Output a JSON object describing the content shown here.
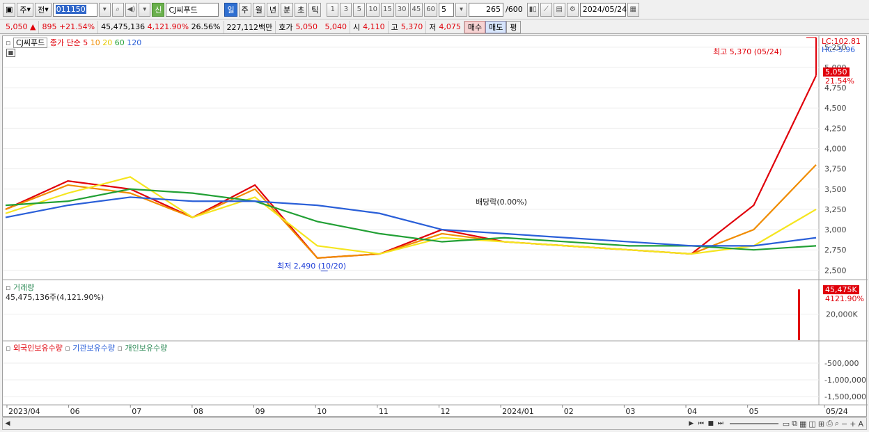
{
  "toolbar": {
    "period_main": "주",
    "period_prev": "전",
    "stock_code": "011150",
    "badge_new": "신",
    "stock_name": "CJ씨푸드",
    "periods": [
      "일",
      "주",
      "월",
      "년",
      "분",
      "초",
      "틱"
    ],
    "selected_period": "일",
    "intervals": [
      "1",
      "3",
      "5",
      "10",
      "15",
      "30",
      "45",
      "60"
    ],
    "interval_input": "5",
    "count": "265",
    "count_total": "/600",
    "date": "2024/05/24"
  },
  "quote": {
    "price": "5,050",
    "change": "895",
    "change_pct": "+21.54%",
    "volume": "45,475,136",
    "volume_pct": "4,121.90%",
    "turnover_pct": "26.56%",
    "amount": "227,112백만",
    "ask_label": "호가",
    "ask": "5,050",
    "bid": "5,040",
    "open_label": "시",
    "open": "4,110",
    "high_label": "고",
    "high": "5,370",
    "low_label": "저",
    "low": "4,075",
    "buy_label": "매수",
    "sell_label": "매도",
    "extra_label": "평"
  },
  "price_pane": {
    "name_label": "CJ씨푸드",
    "ma_label": "종가 단순",
    "ma_periods": [
      "5",
      "10",
      "20",
      "60",
      "120"
    ],
    "lc_label": "LC:102.81",
    "hc_label": "HC:-5.96",
    "axis_ticks": [
      "5,250",
      "5,000",
      "4,750",
      "4,500",
      "4,250",
      "4,000",
      "3,750",
      "3,500",
      "3,250",
      "3,000",
      "2,750",
      "2,500"
    ],
    "current_tag": "5,050",
    "current_pct": "21.54%",
    "high_annotation": "최고 5,370 (05/24)",
    "low_annotation": "최저 2,490 (10/20)",
    "dividend_annotation": "배당락(0.00%)"
  },
  "volume_pane": {
    "title": "거래량",
    "value_label": "45,475,136주(4,121.90%)",
    "axis_tick": "20,000K",
    "current_tag": "45,475K",
    "current_pct": "4121.90%"
  },
  "holding_pane": {
    "foreign_label": "외국인보유수량",
    "inst_label": "기관보유수량",
    "indiv_label": "개인보유수량",
    "axis_ticks": [
      "-500,000",
      "-1,000,000",
      "-1,500,000"
    ]
  },
  "x_axis": {
    "labels": [
      "2023/04",
      "06",
      "07",
      "08",
      "09",
      "10",
      "11",
      "12",
      "2024/01",
      "02",
      "03",
      "04",
      "05",
      "05/24"
    ]
  },
  "colors": {
    "up": "#e0000a",
    "down": "#1f3fd8",
    "ma5": "#e0000a",
    "ma10": "#f08c00",
    "ma20": "#f5e51f",
    "ma60": "#22a035",
    "ma120": "#2a5fd8",
    "foreign": "#e0000a",
    "institution": "#2a5fd8",
    "individual": "#2e8b57"
  },
  "chart_data": {
    "type": "line",
    "title": "CJ씨푸드",
    "x": [
      "2023/04",
      "06",
      "07",
      "08",
      "09",
      "10",
      "11",
      "12",
      "2024/01",
      "02",
      "03",
      "04",
      "05",
      "05/24"
    ],
    "ylim": [
      2400,
      5300
    ],
    "series": [
      {
        "name": "5",
        "values": [
          3250,
          3600,
          3500,
          3150,
          3550,
          2650,
          2700,
          3000,
          2850,
          2800,
          2750,
          2700,
          3300,
          4900
        ]
      },
      {
        "name": "10",
        "values": [
          3250,
          3550,
          3450,
          3150,
          3500,
          2650,
          2700,
          2950,
          2850,
          2800,
          2750,
          2700,
          3000,
          3800
        ]
      },
      {
        "name": "20",
        "values": [
          3200,
          3450,
          3650,
          3150,
          3400,
          2800,
          2700,
          2900,
          2850,
          2800,
          2750,
          2700,
          2800,
          3250
        ]
      },
      {
        "name": "60",
        "values": [
          3300,
          3350,
          3500,
          3450,
          3350,
          3100,
          2950,
          2850,
          2900,
          2850,
          2800,
          2800,
          2750,
          2800
        ]
      },
      {
        "name": "120",
        "values": [
          3150,
          3300,
          3400,
          3350,
          3350,
          3300,
          3200,
          3000,
          2950,
          2900,
          2850,
          2800,
          2800,
          2900
        ]
      }
    ],
    "volume_ylim": [
      0,
      45475
    ],
    "high": {
      "value": 5370,
      "date": "05/24"
    },
    "low": {
      "value": 2490,
      "date": "10/20"
    }
  }
}
